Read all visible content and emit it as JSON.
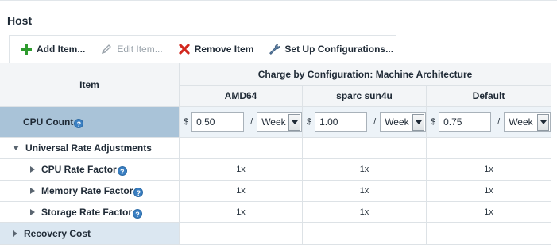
{
  "section": {
    "title": "Host"
  },
  "toolbar": {
    "add_label": "Add Item...",
    "edit_label": "Edit Item...",
    "remove_label": "Remove Item",
    "setup_label": "Set Up Configurations..."
  },
  "grid": {
    "item_header": "Item",
    "group_header": "Charge by Configuration: Machine Architecture",
    "columns": [
      "AMD64",
      "sparc sun4u",
      "Default"
    ],
    "currency_symbol": "$",
    "per_separator": "/",
    "help_glyph": "?",
    "cpu_row": {
      "label": "CPU Count",
      "rates": [
        {
          "value": "0.50",
          "unit": "Week"
        },
        {
          "value": "1.00",
          "unit": "Week"
        },
        {
          "value": "0.75",
          "unit": "Week"
        }
      ]
    },
    "group_row": {
      "label": "Universal Rate Adjustments"
    },
    "factor_rows": [
      {
        "label": "CPU Rate Factor",
        "values": [
          "1x",
          "1x",
          "1x"
        ]
      },
      {
        "label": "Memory Rate Factor",
        "values": [
          "1x",
          "1x",
          "1x"
        ]
      },
      {
        "label": "Storage Rate Factor",
        "values": [
          "1x",
          "1x",
          "1x"
        ]
      }
    ],
    "recovery_row": {
      "label": "Recovery Cost"
    }
  },
  "colors": {
    "selected_row": "#a9c3d8",
    "help_icon": "#3a7fc2",
    "add_icon": "#2e9b2e",
    "remove_icon": "#d2281e"
  }
}
